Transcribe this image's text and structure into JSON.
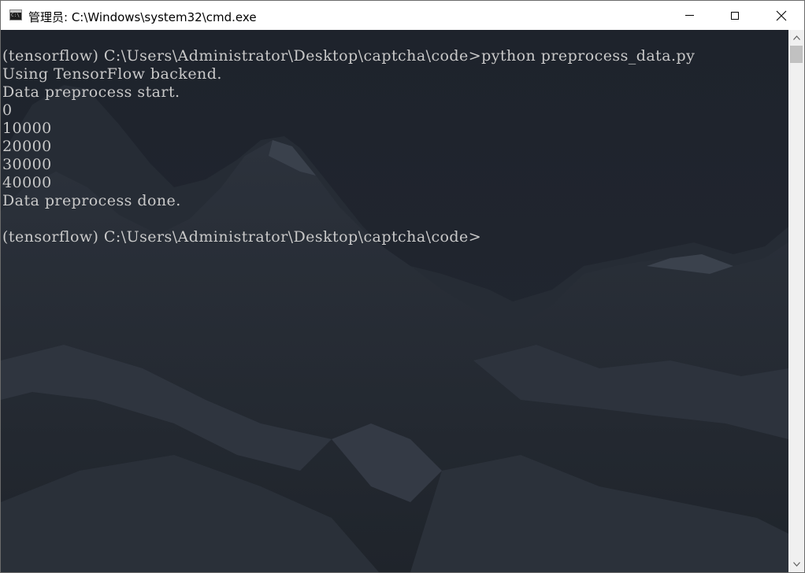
{
  "window": {
    "title": "管理员: C:\\Windows\\system32\\cmd.exe",
    "icon": "cmd-app-icon",
    "controls": {
      "minimize_icon": "minimize-icon",
      "maximize_icon": "maximize-icon",
      "close_icon": "close-icon"
    }
  },
  "console": {
    "lines": [
      "(tensorflow) C:\\Users\\Administrator\\Desktop\\captcha\\code>python preprocess_data.py",
      "Using TensorFlow backend.",
      "Data preprocess start.",
      "0",
      "10000",
      "20000",
      "30000",
      "40000",
      "Data preprocess done.",
      "",
      "(tensorflow) C:\\Users\\Administrator\\Desktop\\captcha\\code>"
    ],
    "text_color": "#c9c9c9",
    "background_color": "#1f242d"
  },
  "scrollbar": {
    "up_icon": "scroll-up-arrow-icon",
    "down_icon": "scroll-down-arrow-icon"
  }
}
